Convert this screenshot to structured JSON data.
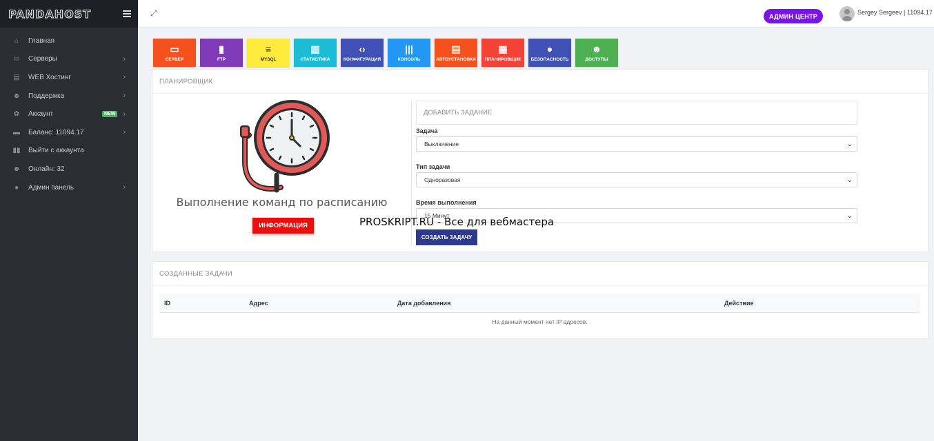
{
  "brand": {
    "logo": "PANDAHOST"
  },
  "sidebar": {
    "items": [
      {
        "label": "Главная",
        "icon": "home-icon",
        "glyph": "⌂",
        "chevron": false
      },
      {
        "label": "Серверы",
        "icon": "server-icon",
        "glyph": "▭",
        "chevron": true
      },
      {
        "label": "WEB Хостинг",
        "icon": "hosting-icon",
        "glyph": "▤",
        "chevron": true
      },
      {
        "label": "Поддержка",
        "icon": "support-icon",
        "glyph": "☻",
        "chevron": true
      },
      {
        "label": "Аккаунт",
        "icon": "gear-icon",
        "glyph": "✿",
        "chevron": true,
        "badge": "NEW"
      },
      {
        "label": "Баланс: 11094.17",
        "icon": "credit-card-icon",
        "glyph": "▬",
        "chevron": true
      },
      {
        "label": "Выйти с аккаунта",
        "icon": "logout-icon",
        "glyph": "▮▮",
        "chevron": false
      },
      {
        "label": "Онлайн: 32",
        "icon": "users-icon",
        "glyph": "☻",
        "chevron": false
      },
      {
        "label": "Админ панель",
        "icon": "globe-icon",
        "glyph": "●",
        "chevron": true
      }
    ]
  },
  "topbar": {
    "admin_button": "АДМИН ЦЕНТР",
    "user": "Sergey Sergeev | 11094.17 ₽"
  },
  "tiles": [
    {
      "label": "СЕРВЕР",
      "color": "#f4511e",
      "icon": "monitor-icon",
      "glyph": "▭"
    },
    {
      "label": "FTP",
      "color": "#7e3ab7",
      "icon": "file-icon",
      "glyph": "▮"
    },
    {
      "label": "MYSQL",
      "color": "#ffeb3b",
      "icon": "database-icon",
      "glyph": "≡"
    },
    {
      "label": "СТАТИСТИКА",
      "color": "#1cbcd4",
      "icon": "bar-chart-icon",
      "glyph": "▥"
    },
    {
      "label": "КОНФИГУРАЦИЯ",
      "color": "#3f51b5",
      "icon": "code-file-icon",
      "glyph": "‹›"
    },
    {
      "label": "КОНСОЛЬ",
      "color": "#2196f3",
      "icon": "barcode-icon",
      "glyph": "|||"
    },
    {
      "label": "АВТОУСТАНОВКА",
      "color": "#f4511e",
      "icon": "document-icon",
      "glyph": "▤"
    },
    {
      "label": "ПЛАНИРОВЩИК",
      "color": "#f44336",
      "icon": "calendar-icon",
      "glyph": "▦"
    },
    {
      "label": "БЕЗОПАСНОСТЬ",
      "color": "#3f51b5",
      "icon": "globe-icon",
      "glyph": "●"
    },
    {
      "label": "ДОСТУПЫ",
      "color": "#4caf50",
      "icon": "users-icon",
      "glyph": "☻"
    }
  ],
  "scheduler": {
    "title": "ПЛАНИРОВЩИК",
    "caption": "Выполнение команд по расписанию",
    "info_button": "ИНФОРМАЦИЯ",
    "form": {
      "title": "ДОБАВИТЬ ЗАДАНИЕ",
      "task_label": "Задача",
      "task_value": "Выключение",
      "type_label": "Тип задачи",
      "type_value": "Одноразовая",
      "time_label": "Время выполнения",
      "time_value": "15 Минут",
      "submit": "СОЗДАТЬ ЗАДАЧУ"
    }
  },
  "watermark": "PROSKRIPT.RU - Все для вебмастера",
  "tasks": {
    "title": "СОЗДАННЫЕ ЗАДАЧИ",
    "columns": [
      "ID",
      "Адрес",
      "Дата добавления",
      "Действие"
    ],
    "empty": "На данный момент нет IP адресов."
  }
}
